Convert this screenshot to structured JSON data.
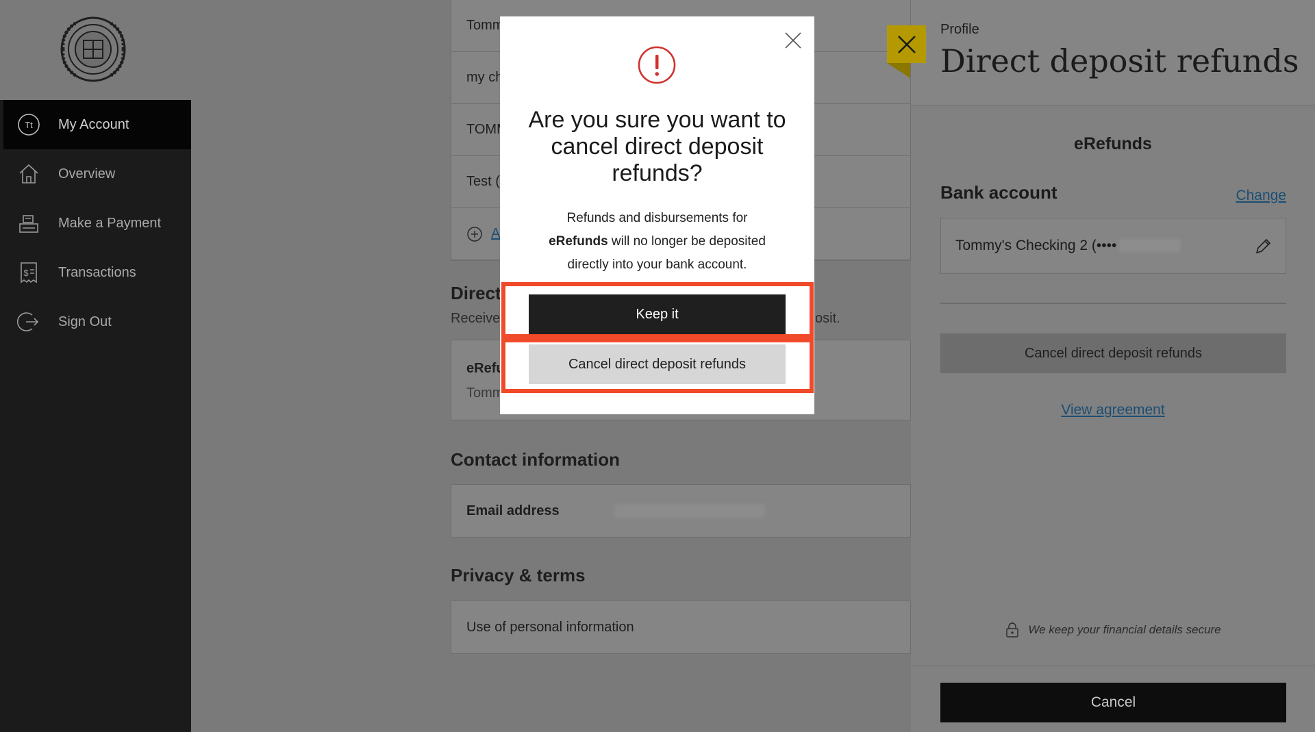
{
  "sidebar": {
    "logo": "university-seal",
    "items": [
      {
        "label": "My Account",
        "icon": "initials-badge",
        "badge": "Tt",
        "active": true
      },
      {
        "label": "Overview",
        "icon": "home-icon"
      },
      {
        "label": "Make a Payment",
        "icon": "register-icon"
      },
      {
        "label": "Transactions",
        "icon": "receipt-icon"
      },
      {
        "label": "Sign Out",
        "icon": "sign-out-icon"
      }
    ]
  },
  "main": {
    "bank_rows": [
      "Tomm",
      "my ch",
      "TOMM",
      "Test ("
    ],
    "add_link": "A",
    "direct_title": "Direct",
    "direct_desc_left": "Receive",
    "direct_desc_right": "osit.",
    "erefunds_row_title": "eRefu",
    "erefunds_row_sub": "Tomm",
    "contact_title": "Contact information",
    "email_label": "Email address",
    "privacy_title": "Privacy & terms",
    "privacy_row": "Use of personal information"
  },
  "panel": {
    "breadcrumb": "Profile",
    "title": "Direct deposit refunds",
    "section_title": "eRefunds",
    "bank_label": "Bank account",
    "change_link": "Change",
    "bank_value": "Tommy's Checking 2 (••••",
    "cancel_dd_button": "Cancel direct deposit refunds",
    "view_agreement": "View agreement",
    "secure_note": "We keep your financial details secure",
    "cancel_button": "Cancel"
  },
  "modal": {
    "title": "Are you sure you want to cancel direct deposit refunds?",
    "body_line1": "Refunds and disbursements for",
    "body_bold": "eRefunds",
    "body_line2": " will no longer be deposited directly into your bank account.",
    "keep_button": "Keep it",
    "cancel_button": "Cancel direct deposit refunds"
  },
  "colors": {
    "highlight": "#f04a2a",
    "alert": "#d0312d",
    "close_flag": "#b49a00"
  }
}
